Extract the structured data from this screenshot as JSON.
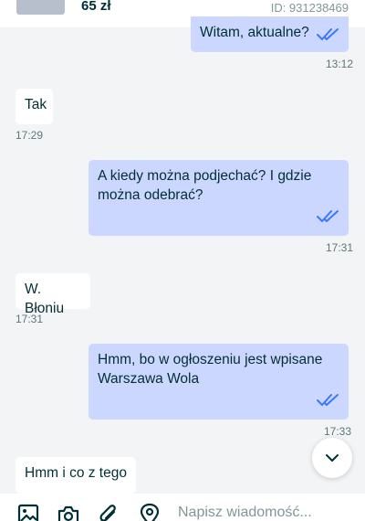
{
  "listing": {
    "price": "65 zł",
    "id_label": "ID: 931238469"
  },
  "messages": [
    {
      "direction": "outgoing",
      "text": "Witam, aktualne?",
      "time": "13:12",
      "read": true
    },
    {
      "direction": "incoming",
      "text": "Tak",
      "time": "17:29"
    },
    {
      "direction": "outgoing",
      "text": "A kiedy można podjechać? I gdzie można odebrać?",
      "time": "17:31",
      "read": true
    },
    {
      "direction": "incoming",
      "text": "W. Błoniu",
      "time": "17:31"
    },
    {
      "direction": "outgoing",
      "text": "Hmm, bo w ogłoszeniu jest wpisane Warszawa Wola",
      "time": "17:33",
      "read": true
    },
    {
      "direction": "incoming",
      "text": "Hmm i co z tego"
    }
  ],
  "composer": {
    "placeholder": "Napisz wiadomość..."
  },
  "icons": {
    "read_receipt": "double-check-icon",
    "scroll_down": "chevron-down-icon",
    "gallery": "image-icon",
    "camera": "camera-icon",
    "attach": "paperclip-icon",
    "location": "location-pin-icon"
  },
  "colors": {
    "outgoing_bubble": "#ccd7ff",
    "incoming_bubble": "#ffffff",
    "read_receipt": "#3a77ff",
    "text": "#002f34"
  }
}
